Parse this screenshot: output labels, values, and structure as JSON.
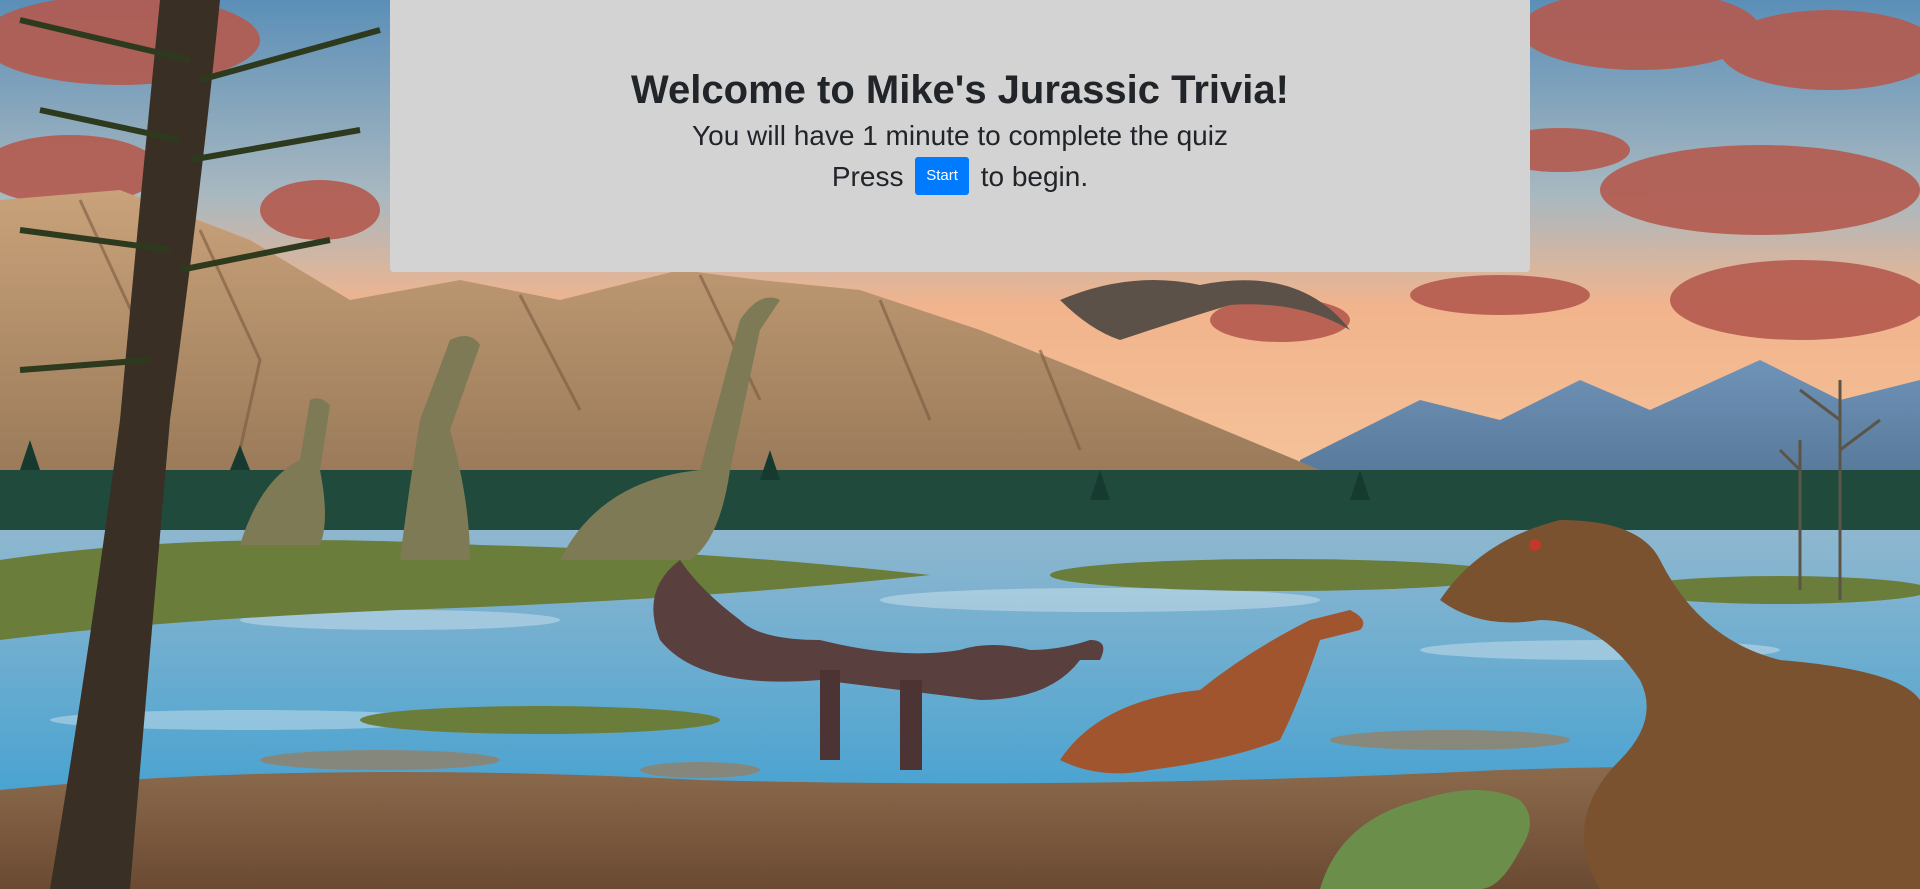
{
  "intro": {
    "title": "Welcome to Mike's Jurassic Trivia!",
    "subtitle": "You will have 1 minute to complete the quiz",
    "press_prefix": "Press",
    "start_label": "Start",
    "press_suffix": "to begin."
  },
  "colors": {
    "card_background": "#d3d3d3",
    "button_primary": "#007bff",
    "text": "#212529"
  }
}
